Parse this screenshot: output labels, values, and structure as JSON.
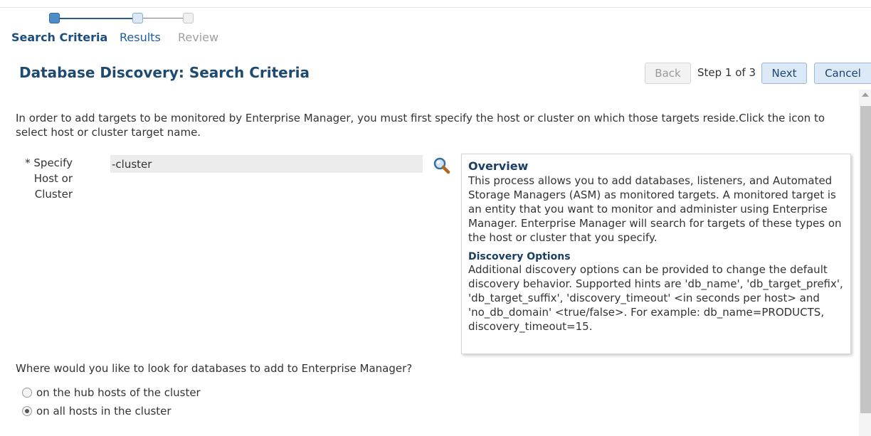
{
  "train": {
    "steps": [
      {
        "label": "Search Criteria",
        "state": "current"
      },
      {
        "label": "Results",
        "state": "next"
      },
      {
        "label": "Review",
        "state": "disabled"
      }
    ]
  },
  "header": {
    "title": "Database Discovery: Search Criteria",
    "back_label": "Back",
    "step_text": "Step 1 of 3",
    "next_label": "Next",
    "cancel_label": "Cancel"
  },
  "intro_text": "In order to add targets to be monitored by Enterprise Manager, you must first specify the host or cluster on which those targets reside.Click the icon to select host or cluster target name.",
  "host_field": {
    "label_required": "*",
    "label": "Specify Host or Cluster",
    "value": "-cluster",
    "search_icon": "magnifier-icon"
  },
  "info": {
    "heading": "Overview",
    "text": "This process allows you to add databases, listeners, and Automated Storage Managers (ASM) as monitored targets. A monitored target is an entity that you want to monitor and administer using Enterprise Manager. Enterprise Manager will search for targets of these types on the host or cluster that you specify.",
    "subheading": "Discovery Options",
    "subtext": "Additional discovery options can be provided to change the default discovery behavior. Supported hints are 'db_name', 'db_target_prefix', 'db_target_suffix', 'discovery_timeout' <in seconds per host> and 'no_db_domain' <true/false>. For example: db_name=PRODUCTS, discovery_timeout=15."
  },
  "question": "Where would you like to look for databases to add to Enterprise Manager?",
  "options": [
    {
      "label": "on the hub hosts of the cluster",
      "selected": false
    },
    {
      "label": "on all hosts in the cluster",
      "selected": true
    }
  ],
  "colors": {
    "title": "#1e4a70",
    "train_active": "#4d8cc9",
    "button_bg": "#dbe8f6"
  }
}
